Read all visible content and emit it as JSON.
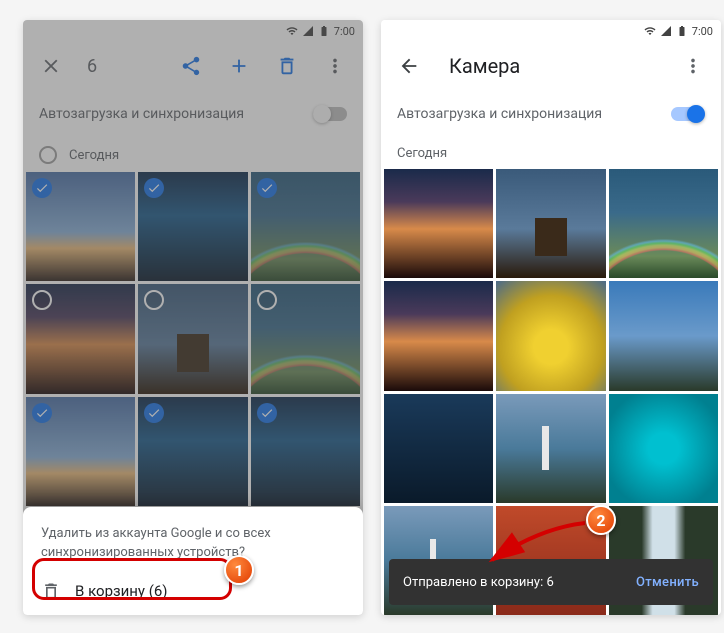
{
  "statusbar": {
    "time": "7:00"
  },
  "left": {
    "selection_count": "6",
    "sync_label": "Автозагрузка и синхронизация",
    "section_label": "Сегодня",
    "thumbs": [
      {
        "art": "sky",
        "selected": true
      },
      {
        "art": "mtn",
        "selected": true
      },
      {
        "art": "rb",
        "selected": true
      },
      {
        "art": "sunset",
        "selected": false
      },
      {
        "art": "castle",
        "selected": false
      },
      {
        "art": "rb",
        "selected": false
      },
      {
        "art": "sky",
        "selected": true
      },
      {
        "art": "mtn",
        "selected": true
      },
      {
        "art": "mtn",
        "selected": true
      }
    ],
    "sheet_msg": "Удалить из аккаунта Google и со всех синхронизированных устройств?",
    "sheet_action": "В корзину (6)"
  },
  "right": {
    "title": "Камера",
    "sync_label": "Автозагрузка и синхронизация",
    "section_label": "Сегодня",
    "thumbs": [
      {
        "art": "sunset"
      },
      {
        "art": "castle"
      },
      {
        "art": "rb"
      },
      {
        "art": "sunset"
      },
      {
        "art": "field"
      },
      {
        "art": "mtn2"
      },
      {
        "art": "dusk"
      },
      {
        "art": "coast"
      },
      {
        "art": "reef"
      },
      {
        "art": "coast"
      },
      {
        "art": "autumn"
      },
      {
        "art": "wfall"
      }
    ],
    "snackbar_text": "Отправлено в корзину: 6",
    "snackbar_action": "Отменить"
  },
  "annotations": {
    "badge1": "1",
    "badge2": "2"
  }
}
